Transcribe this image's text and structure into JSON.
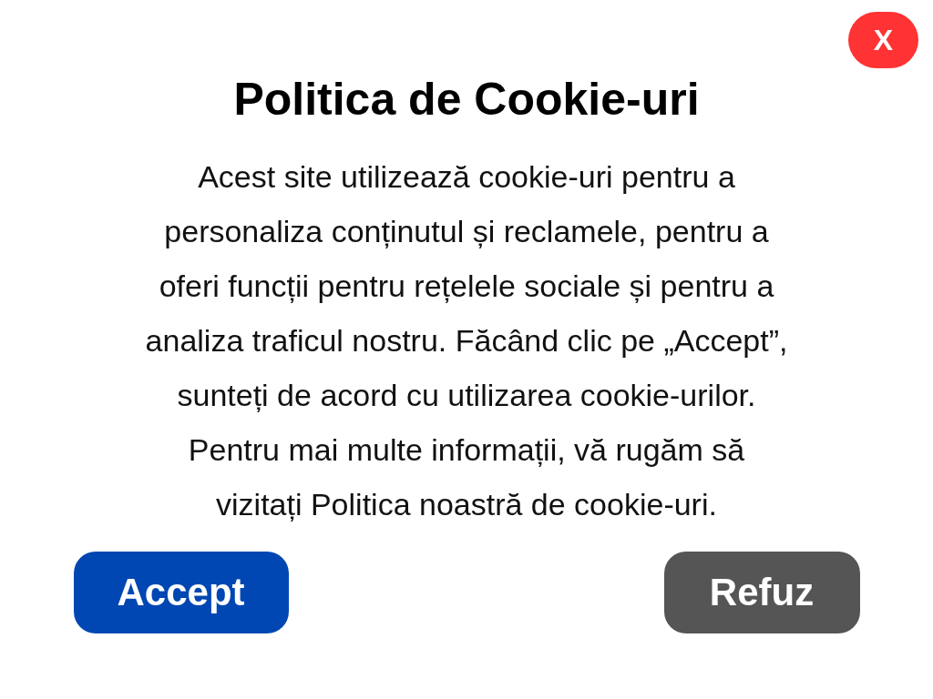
{
  "close_button": {
    "label": "X"
  },
  "title": "Politica de Cookie-uri",
  "message": "Acest site utilizează cookie-uri pentru a\npersonaliza conținutul și reclamele, pentru a\noferi funcții pentru rețelele sociale și pentru a\nanaliza traficul nostru. Făcând clic pe „Accept”,\nsunteți de acord cu utilizarea cookie-urilor.\nPentru mai multe informații, vă rugăm să\nvizitați Politica noastră de cookie-uri.",
  "buttons": [
    {
      "label": "Accept",
      "kind": "primary"
    },
    {
      "label": "Refuz",
      "kind": "secondary"
    }
  ]
}
